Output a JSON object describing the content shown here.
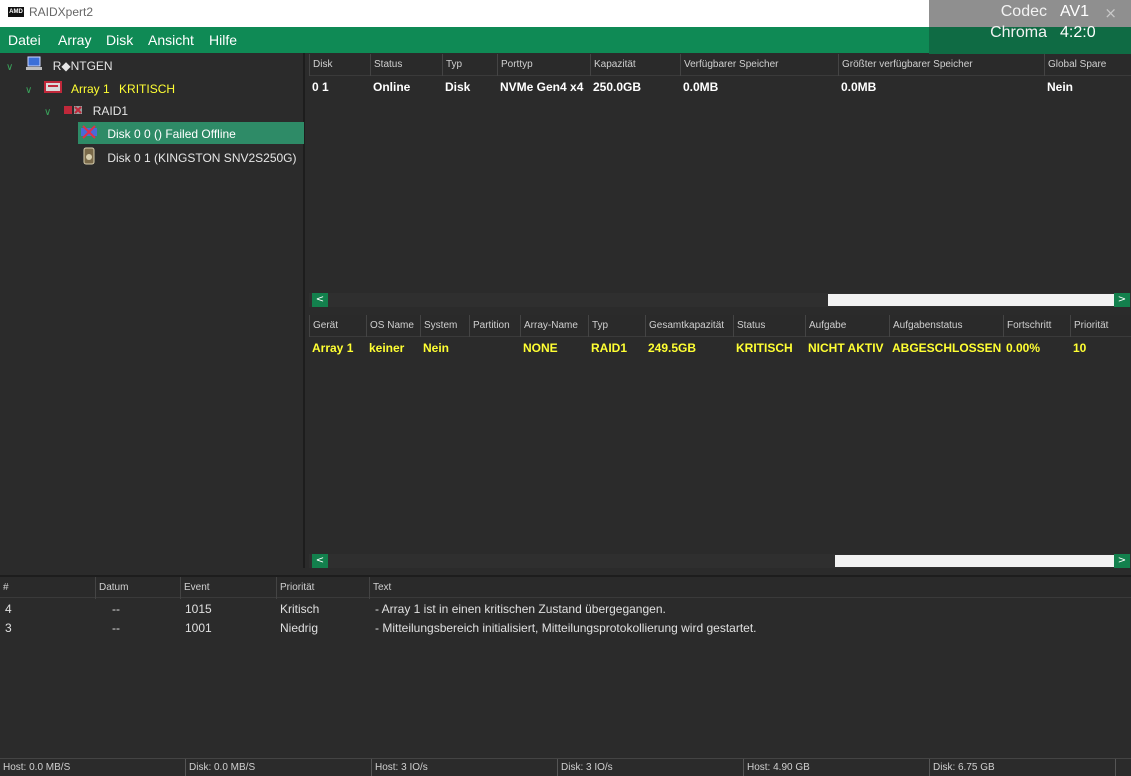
{
  "window": {
    "title": "RAIDXpert2",
    "logo_text": "AMD"
  },
  "overlay": {
    "codec_label": "Codec",
    "codec_value": "AV1",
    "chroma_label": "Chroma",
    "chroma_value": "4:2:0",
    "close_glyph": "×"
  },
  "menu": [
    "Datei",
    "Array",
    "Disk",
    "Ansicht",
    "Hilfe"
  ],
  "tree": {
    "host": "R◆NTGEN",
    "array_name": "Array 1",
    "array_state": "KRITISCH",
    "raid": "RAID1",
    "disk_failed": "Disk 0 0 ()  Failed Offline",
    "disk_ok": "Disk 0 1 (KINGSTON SNV2S250G)"
  },
  "disk_table": {
    "headers": [
      "Disk",
      "Status",
      "Typ",
      "Porttyp",
      "Kapazität",
      "Verfügbarer Speicher",
      "Größter verfügbarer Speicher",
      "Global Spare"
    ],
    "rows": [
      [
        "0 1",
        "Online",
        "Disk",
        "NVMe Gen4 x4",
        "250.0GB",
        "0.0MB",
        "0.0MB",
        "Nein"
      ]
    ]
  },
  "array_table": {
    "headers": [
      "Gerät",
      "OS Name",
      "System",
      "Partition",
      "Array-Name",
      "Typ",
      "Gesamtkapazität",
      "Status",
      "Aufgabe",
      "Aufgabenstatus",
      "Fortschritt",
      "Priorität"
    ],
    "rows": [
      [
        "Array 1",
        "keiner",
        "Nein",
        "",
        "NONE",
        "RAID1",
        "249.5GB",
        "KRITISCH",
        "NICHT AKTIV",
        "ABGESCHLOSSEN",
        "0.00%",
        "10"
      ]
    ]
  },
  "event_log": {
    "headers": [
      "#",
      "Datum",
      "Event",
      "Priorität",
      "Text"
    ],
    "rows": [
      [
        "4",
        "--",
        "1015",
        "Kritisch",
        "- Array 1 ist in einen kritischen Zustand übergegangen."
      ],
      [
        "3",
        "--",
        "1001",
        "Niedrig",
        "- Mitteilungsbereich initialisiert, Mitteilungsprotokollierung wird gestartet."
      ]
    ]
  },
  "statusbar": [
    "Host: 0.0 MB/S",
    "Disk: 0.0 MB/S",
    "Host: 3 IO/s",
    "Disk: 3 IO/s",
    "Host: 4.90 GB",
    "Disk: 6.75 GB"
  ],
  "colors": {
    "accent_green": "#0f8a55",
    "tree_selection": "#2e8b67",
    "critical_yellow": "#ffff33",
    "background": "#2b2b2b"
  },
  "icons": {
    "scroll_left": "<",
    "scroll_right": ">",
    "chevron": "∨"
  }
}
